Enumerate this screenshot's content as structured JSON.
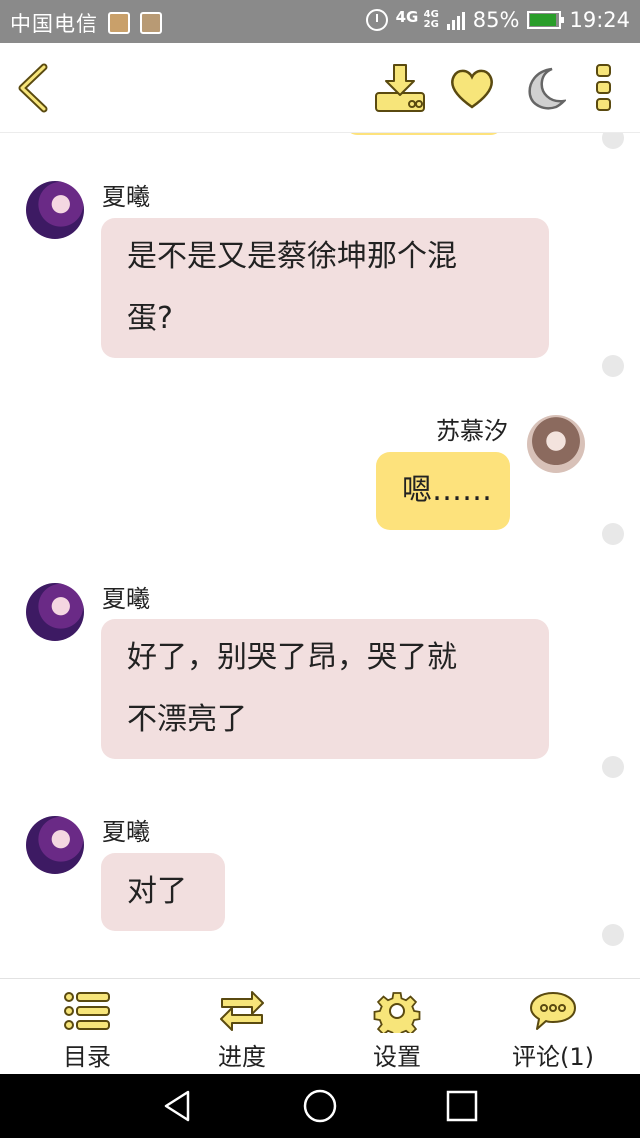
{
  "status_bar": {
    "carrier": "中国电信",
    "network_top": "4G",
    "network_small": "4G",
    "network_small2": "2G",
    "battery": "85%",
    "time": "19:24"
  },
  "toolbar": {
    "back_icon": "chevron-left-icon",
    "download_icon": "download-icon",
    "favorite_icon": "heart-icon",
    "night_icon": "moon-icon",
    "more_icon": "more-vertical-icon"
  },
  "colors": {
    "accent_yellow": "#fde27c",
    "bubble_left": "#f2dfdf",
    "icon_yellow": "#f7e57a",
    "icon_stroke": "#5a4a10"
  },
  "messages": [
    {
      "sender": "夏曦",
      "side": "left",
      "line1": "是不是又是蔡徐坤那个混",
      "line2": "蛋?"
    },
    {
      "sender": "苏慕汐",
      "side": "right",
      "line1": "嗯……"
    },
    {
      "sender": "夏曦",
      "side": "left",
      "line1": "好了，别哭了昂，哭了就",
      "line2": "不漂亮了"
    },
    {
      "sender": "夏曦",
      "side": "left",
      "line1": "对了"
    }
  ],
  "bottom_nav": {
    "catalog": "目录",
    "progress": "进度",
    "settings": "设置",
    "comments": "评论(1)"
  }
}
